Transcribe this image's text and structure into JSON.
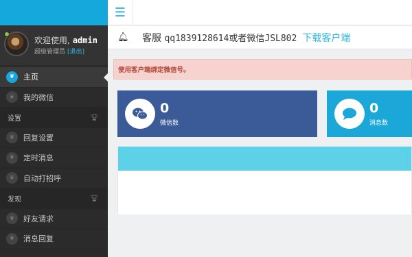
{
  "user": {
    "welcome": "欢迎使用,",
    "name": "admin",
    "role": "超级管理员",
    "logout": "[退出]"
  },
  "sidebar": {
    "items": [
      {
        "label": "主页",
        "active": true
      },
      {
        "label": "我的微信",
        "active": false
      }
    ],
    "groups": [
      {
        "label": "设置",
        "items": [
          "回复设置",
          "定时消息",
          "自动打招呼"
        ]
      },
      {
        "label": "发现",
        "items": [
          "好友请求",
          "消息回复"
        ]
      }
    ]
  },
  "notice": {
    "text_prefix": "客服",
    "contact": "qq1839128614或者微信JSL802",
    "link": "下载客户端"
  },
  "alert": {
    "message": "使用客户端绑定微信号。"
  },
  "stats": [
    {
      "value": "0",
      "label": "微信数",
      "color": "#3a5a98",
      "icon": "wechat-icon"
    },
    {
      "value": "0",
      "label": "消息数",
      "color": "#1ba8d8",
      "icon": "chat-bubble-icon"
    }
  ],
  "colors": {
    "accent": "#1aa5dc",
    "sidebar_bg": "#2b2b2b",
    "alert_bg": "#f7d3cf",
    "panel_header": "#5cd1e8"
  }
}
